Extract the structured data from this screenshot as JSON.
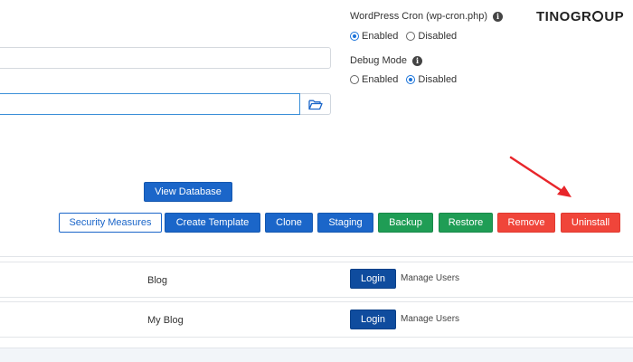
{
  "brand": {
    "logo_text_left": "TINO",
    "logo_text_right": "GR",
    "logo_text_end": "UP"
  },
  "settings": {
    "cron": {
      "label": "WordPress Cron (wp-cron.php)",
      "options": [
        {
          "label": "Enabled",
          "checked": true
        },
        {
          "label": "Disabled",
          "checked": false
        }
      ]
    },
    "debug": {
      "label": "Debug Mode",
      "options": [
        {
          "label": "Enabled",
          "checked": false
        },
        {
          "label": "Disabled",
          "checked": true
        }
      ]
    }
  },
  "fields": {
    "top_input": {
      "value": ""
    },
    "path_input": {
      "value": ""
    }
  },
  "buttons": {
    "view_database": "View Database",
    "security_measures": "Security Measures",
    "create_template": "Create Template",
    "clone": "Clone",
    "staging": "Staging",
    "backup": "Backup",
    "restore": "Restore",
    "remove": "Remove",
    "uninstall": "Uninstall"
  },
  "sites": [
    {
      "name": "Blog",
      "login_label": "Login",
      "manage_label": "Manage Users"
    },
    {
      "name": "My Blog",
      "login_label": "Login",
      "manage_label": "Manage Users"
    }
  ],
  "colors": {
    "primary": "#1b66c9",
    "success": "#1f9d55",
    "danger": "#f0453a",
    "annotation_arrow": "#e8262b"
  }
}
